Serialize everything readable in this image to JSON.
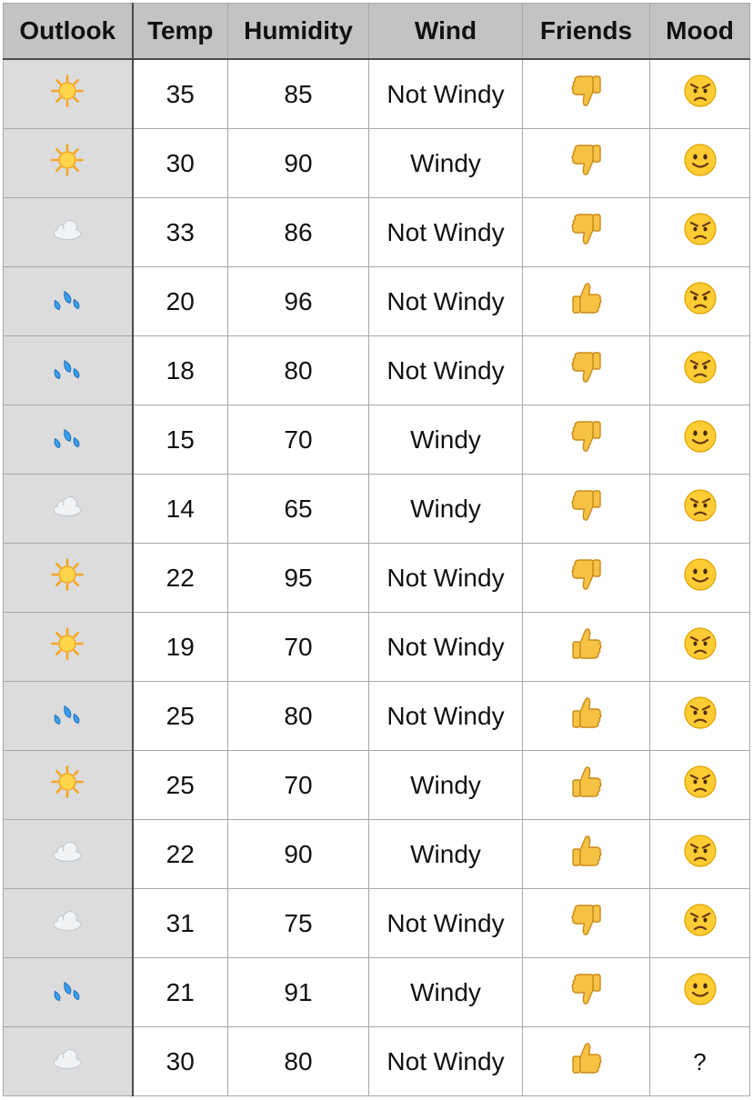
{
  "headers": {
    "outlook": "Outlook",
    "temp": "Temp",
    "humidity": "Humidity",
    "wind": "Wind",
    "friends": "Friends",
    "mood": "Mood"
  },
  "rows": [
    {
      "outlook": "sun-icon",
      "temp": "35",
      "humidity": "85",
      "wind": "Not Windy",
      "friends": "thumbs-down-icon",
      "mood": "angry-face-icon"
    },
    {
      "outlook": "sun-icon",
      "temp": "30",
      "humidity": "90",
      "wind": "Windy",
      "friends": "thumbs-down-icon",
      "mood": "smile-face-icon"
    },
    {
      "outlook": "cloud-icon",
      "temp": "33",
      "humidity": "86",
      "wind": "Not Windy",
      "friends": "thumbs-down-icon",
      "mood": "angry-face-icon"
    },
    {
      "outlook": "rain-drops-icon",
      "temp": "20",
      "humidity": "96",
      "wind": "Not Windy",
      "friends": "thumbs-up-icon",
      "mood": "angry-face-icon"
    },
    {
      "outlook": "rain-drops-icon",
      "temp": "18",
      "humidity": "80",
      "wind": "Not Windy",
      "friends": "thumbs-down-icon",
      "mood": "angry-face-icon"
    },
    {
      "outlook": "rain-drops-icon",
      "temp": "15",
      "humidity": "70",
      "wind": "Windy",
      "friends": "thumbs-down-icon",
      "mood": "smile-face-icon"
    },
    {
      "outlook": "cloud-icon",
      "temp": "14",
      "humidity": "65",
      "wind": "Windy",
      "friends": "thumbs-down-icon",
      "mood": "angry-face-icon"
    },
    {
      "outlook": "sun-icon",
      "temp": "22",
      "humidity": "95",
      "wind": "Not Windy",
      "friends": "thumbs-down-icon",
      "mood": "smile-face-icon"
    },
    {
      "outlook": "sun-icon",
      "temp": "19",
      "humidity": "70",
      "wind": "Not Windy",
      "friends": "thumbs-up-icon",
      "mood": "angry-face-icon"
    },
    {
      "outlook": "rain-drops-icon",
      "temp": "25",
      "humidity": "80",
      "wind": "Not Windy",
      "friends": "thumbs-up-icon",
      "mood": "angry-face-icon"
    },
    {
      "outlook": "sun-icon",
      "temp": "25",
      "humidity": "70",
      "wind": "Windy",
      "friends": "thumbs-up-icon",
      "mood": "angry-face-icon"
    },
    {
      "outlook": "cloud-icon",
      "temp": "22",
      "humidity": "90",
      "wind": "Windy",
      "friends": "thumbs-up-icon",
      "mood": "angry-face-icon"
    },
    {
      "outlook": "cloud-icon",
      "temp": "31",
      "humidity": "75",
      "wind": "Not Windy",
      "friends": "thumbs-down-icon",
      "mood": "angry-face-icon"
    },
    {
      "outlook": "rain-drops-icon",
      "temp": "21",
      "humidity": "91",
      "wind": "Windy",
      "friends": "thumbs-down-icon",
      "mood": "smile-face-icon"
    },
    {
      "outlook": "cloud-icon",
      "temp": "30",
      "humidity": "80",
      "wind": "Not Windy",
      "friends": "thumbs-up-icon",
      "mood": "?"
    }
  ]
}
